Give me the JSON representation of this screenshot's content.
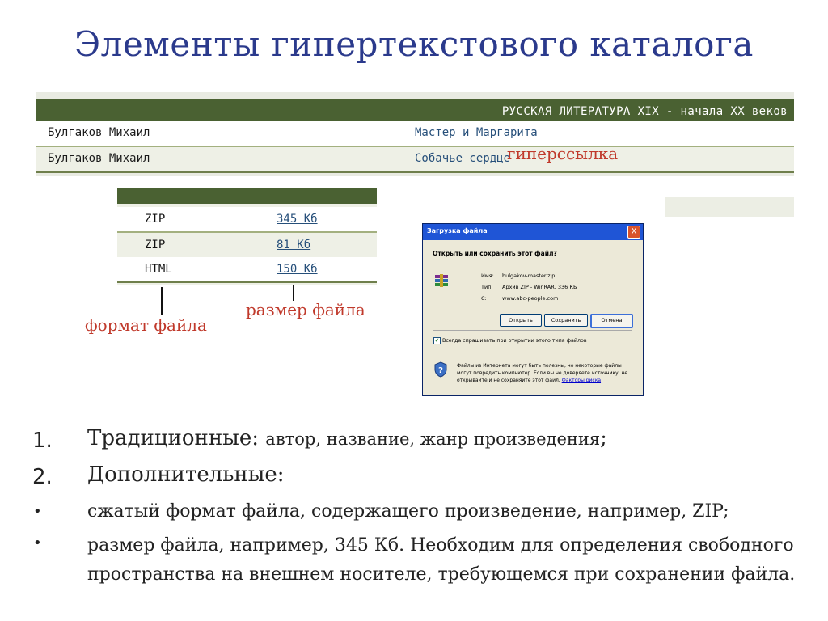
{
  "title": "Элементы гипертекстового каталога",
  "catalog": {
    "header": "РУССКАЯ ЛИТЕРАТУРА XIX - начала XX веков",
    "rows": [
      {
        "author": "Булгаков Михаил",
        "work": "Мастер и Маргарита"
      },
      {
        "author": "Булгаков Михаил",
        "work": "Собачье сердце"
      }
    ],
    "hyperlink_label": "гиперссылка"
  },
  "file_table": {
    "rows": [
      {
        "format": "ZIP",
        "size": "345 Кб"
      },
      {
        "format": "ZIP",
        "size": "81 Кб"
      },
      {
        "format": "HTML",
        "size": "150 Кб"
      }
    ],
    "format_label": "формат файла",
    "size_label": "размер файла"
  },
  "dialog": {
    "title": "Загрузка файла",
    "close": "X",
    "question": "Открыть или сохранить этот файл?",
    "name_label": "Имя:",
    "name_value": "bulgakov-master.zip",
    "type_label": "Тип:",
    "type_value": "Архив ZIP - WinRAR, 336 КБ",
    "from_label": "С:",
    "from_value": "www.abc-people.com",
    "open_button": "Открыть",
    "save_button": "Сохранить",
    "cancel_button": "Отмена",
    "checkbox_label": "Всегда спрашивать при открытии этого типа файлов",
    "warning_text": "Файлы из Интернета могут быть полезны, но некоторые файлы могут повредить компьютер. Если вы не доверяете источнику, не открывайте и не сохраняйте этот файл.",
    "warning_link": "Факторы риска"
  },
  "list": {
    "item1_num": "1.",
    "item1_lead": "Традиционные:",
    "item1_rest": "автор, название, жанр произведения",
    "item1_end": ";",
    "item2_num": "2.",
    "item2_lead": "Дополнительные:",
    "bullet": "•",
    "bullet1_text": "сжатый  формат файла, содержащего произведение, например, ZIP;",
    "bullet2_text": "размер файла, например, 345 Кб. Необходим для определения свободного пространства на внешнем носителе, требующемся при сохранении файла."
  },
  "colors": {
    "title": "#2b3a8c",
    "table_header": "#4a6132",
    "link": "#264f7a",
    "annotation": "#c0392b"
  }
}
